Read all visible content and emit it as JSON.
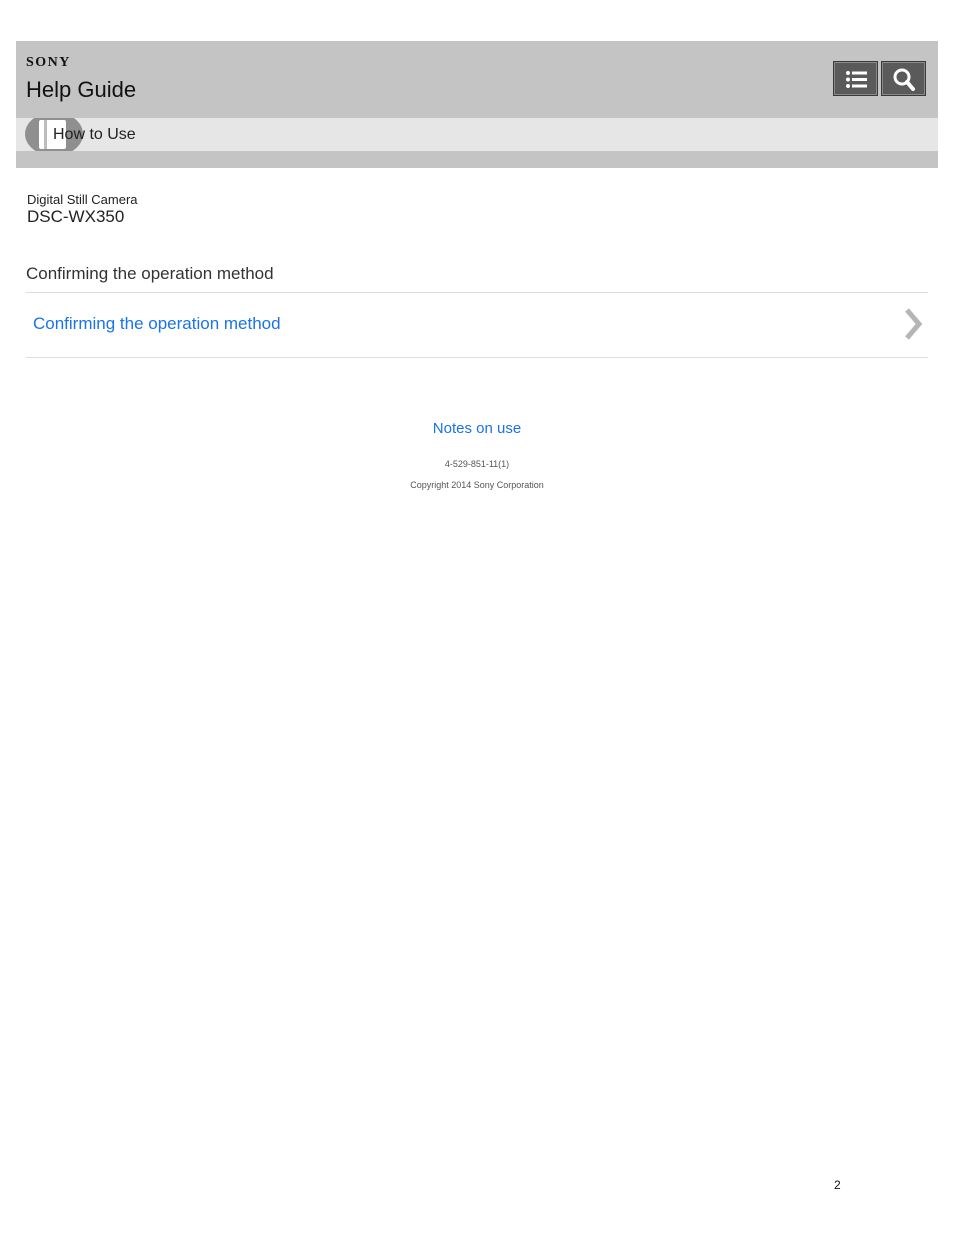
{
  "header": {
    "brand": "SONY",
    "title": "Help Guide",
    "toc_icon": "list-icon",
    "search_icon": "search-icon"
  },
  "breadcrumb": {
    "icon": "book-icon",
    "label": "How to Use"
  },
  "product": {
    "category": "Digital Still Camera",
    "model": "DSC-WX350"
  },
  "section": {
    "heading": "Confirming the operation method",
    "items": [
      {
        "label": "Confirming the operation method",
        "icon": "chevron-right-icon"
      }
    ]
  },
  "footer": {
    "link": "Notes on use",
    "doc_number": "4-529-851-11(1)",
    "copyright": "Copyright 2014 Sony Corporation"
  },
  "page": {
    "number": "2"
  },
  "colors": {
    "header_bg": "#c4c4c4",
    "crumb_bg": "#e6e6e6",
    "link": "#1a73e8"
  }
}
